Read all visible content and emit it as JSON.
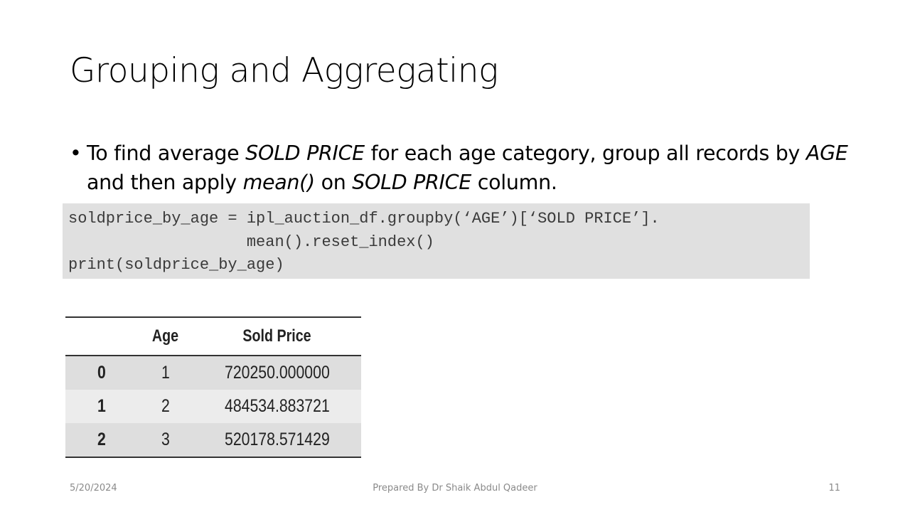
{
  "slide": {
    "title": "Grouping and Aggregating",
    "bullet": {
      "t1": "To find average ",
      "i1": "SOLD PRICE",
      "t2": " for each age category, group all records by ",
      "i2": "AGE",
      "t3": " and then apply ",
      "i3": "mean()",
      "t4": " on ",
      "i4": "SOLD PRICE",
      "t5": " column."
    },
    "code": [
      "soldprice_by_age = ipl_auction_df.groupby(‘AGE’)[‘SOLD PRICE’].",
      "                   mean().reset_index()",
      "print(soldprice_by_age)"
    ],
    "table": {
      "headers": [
        "",
        "Age",
        "Sold Price"
      ],
      "rows": [
        [
          "0",
          "1",
          "720250.000000"
        ],
        [
          "1",
          "2",
          "484534.883721"
        ],
        [
          "2",
          "3",
          "520178.571429"
        ]
      ]
    }
  },
  "footer": {
    "date": "5/20/2024",
    "author": "Prepared By Dr Shaik Abdul Qadeer",
    "page": "11"
  }
}
